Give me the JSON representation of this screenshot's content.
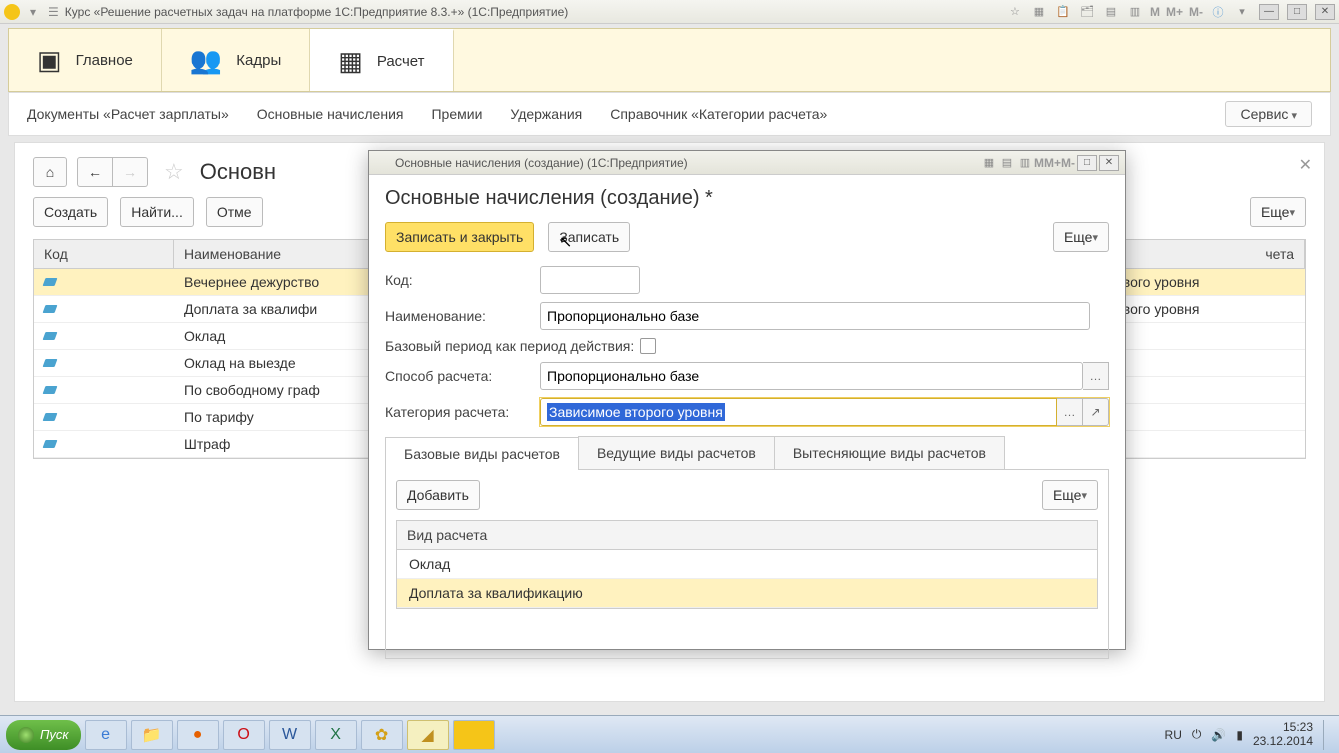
{
  "titlebar": {
    "title": "Курс «Решение расчетных задач на платформе 1С:Предприятие 8.3.+» (1С:Предприятие)",
    "m_buttons": [
      "M",
      "M+",
      "M-"
    ]
  },
  "mainnav": {
    "tabs": [
      {
        "icon": "⚙",
        "label": "Главное"
      },
      {
        "icon": "👥",
        "label": "Кадры"
      },
      {
        "icon": "▦",
        "label": "Расчет"
      }
    ]
  },
  "subnav": {
    "items": [
      "Документы «Расчет зарплаты»",
      "Основные начисления",
      "Премии",
      "Удержания",
      "Справочник «Категории расчета»"
    ],
    "service": "Сервис"
  },
  "page": {
    "title_partial": "Основн",
    "create": "Создать",
    "find": "Найти...",
    "cancel": "Отме",
    "more": "Еще"
  },
  "grid": {
    "headers": {
      "code": "Код",
      "name": "Наименование",
      "cat_partial": "чета"
    },
    "rows": [
      {
        "name": "Вечернее дежурство",
        "cat": "рвого уровня",
        "selected": true
      },
      {
        "name": "Доплата за квалифи",
        "cat": "рвого уровня"
      },
      {
        "name": "Оклад"
      },
      {
        "name": "Оклад на выезде"
      },
      {
        "name": "По свободному граф"
      },
      {
        "name": "По тарифу"
      },
      {
        "name": "Штраф"
      }
    ]
  },
  "dialog": {
    "window_title": "Основные начисления (создание)  (1С:Предприятие)",
    "heading": "Основные начисления (создание) *",
    "save_close": "Записать и закрыть",
    "save": "Записать",
    "more": "Еще",
    "labels": {
      "code": "Код:",
      "name": "Наименование:",
      "base_period": "Базовый период как период действия:",
      "method": "Способ расчета:",
      "category": "Категория расчета:"
    },
    "values": {
      "code": "",
      "name": "Пропорционально базе",
      "method": "Пропорционально базе",
      "category": "Зависимое второго уровня"
    },
    "tabs": [
      "Базовые виды расчетов",
      "Ведущие виды расчетов",
      "Вытесняющие виды расчетов"
    ],
    "panel": {
      "add": "Добавить",
      "more": "Еще",
      "header": "Вид расчета",
      "rows": [
        "Оклад",
        "Доплата за квалификацию"
      ]
    },
    "m_buttons": [
      "M",
      "M+",
      "M-"
    ]
  },
  "taskbar": {
    "start": "Пуск",
    "lang": "RU",
    "time": "15:23",
    "date": "23.12.2014"
  }
}
